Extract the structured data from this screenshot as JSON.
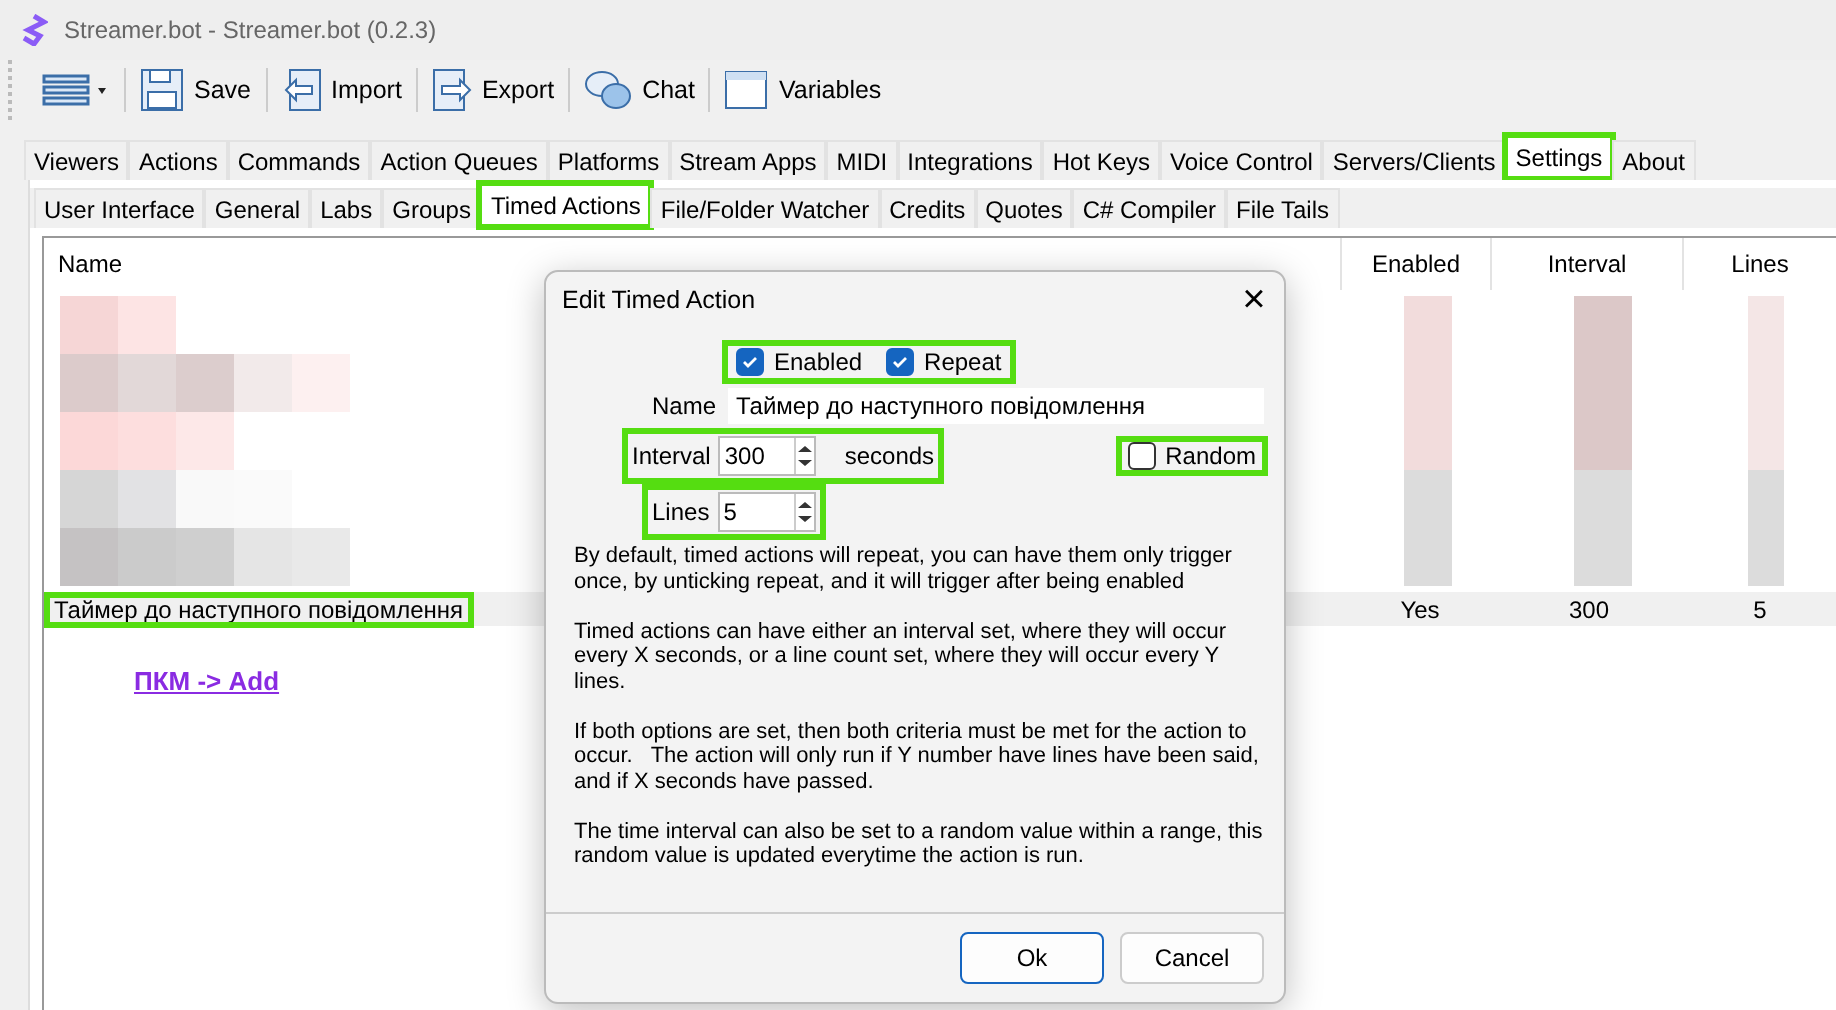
{
  "window": {
    "title": "Streamer.bot - Streamer.bot (0.2.3)"
  },
  "toolbar": [
    {
      "kind": "menu"
    },
    {
      "kind": "save",
      "label": "Save"
    },
    {
      "kind": "import",
      "label": "Import"
    },
    {
      "kind": "export",
      "label": "Export"
    },
    {
      "kind": "chat",
      "label": "Chat"
    },
    {
      "kind": "variables",
      "label": "Variables"
    }
  ],
  "tabs": [
    {
      "label": "Viewers",
      "selected": false,
      "highlighted": false
    },
    {
      "label": "Actions",
      "selected": false,
      "highlighted": false
    },
    {
      "label": "Commands",
      "selected": false,
      "highlighted": false
    },
    {
      "label": "Action Queues",
      "selected": false,
      "highlighted": false
    },
    {
      "label": "Platforms",
      "selected": false,
      "highlighted": false
    },
    {
      "label": "Stream Apps",
      "selected": false,
      "highlighted": false
    },
    {
      "label": "MIDI",
      "selected": false,
      "highlighted": false
    },
    {
      "label": "Integrations",
      "selected": false,
      "highlighted": false
    },
    {
      "label": "Hot Keys",
      "selected": false,
      "highlighted": false
    },
    {
      "label": "Voice Control",
      "selected": false,
      "highlighted": false
    },
    {
      "label": "Servers/Clients",
      "selected": false,
      "highlighted": false
    },
    {
      "label": "Settings",
      "selected": true,
      "highlighted": true
    },
    {
      "label": "About",
      "selected": false,
      "highlighted": false
    }
  ],
  "subtabs": [
    {
      "label": "User Interface",
      "selected": false,
      "highlighted": false
    },
    {
      "label": "General",
      "selected": false,
      "highlighted": false
    },
    {
      "label": "Labs",
      "selected": false,
      "highlighted": false
    },
    {
      "label": "Groups",
      "selected": false,
      "highlighted": false
    },
    {
      "label": "Timed Actions",
      "selected": true,
      "highlighted": true
    },
    {
      "label": "File/Folder Watcher",
      "selected": false,
      "highlighted": false
    },
    {
      "label": "Credits",
      "selected": false,
      "highlighted": false
    },
    {
      "label": "Quotes",
      "selected": false,
      "highlighted": false
    },
    {
      "label": "C# Compiler",
      "selected": false,
      "highlighted": false
    },
    {
      "label": "File Tails",
      "selected": false,
      "highlighted": false
    }
  ],
  "table": {
    "columns": [
      "Name",
      "Enabled",
      "Interval",
      "Lines"
    ],
    "rows": [
      {
        "cells": [
          "Таймер до наступного повідомлення",
          "Yes",
          "300",
          "5"
        ],
        "selected": true,
        "highlighted": true
      }
    ]
  },
  "annotation": {
    "text": "ПКМ -> Add"
  },
  "dialog": {
    "title": "Edit Timed Action",
    "close": "×",
    "enabled": {
      "label": "Enabled",
      "checked": true
    },
    "repeat": {
      "label": "Repeat",
      "checked": true
    },
    "checks_highlighted": true,
    "name": {
      "label": "Name",
      "value": "Таймер до наступного повідомлення"
    },
    "interval": {
      "label": "Interval",
      "value": "300",
      "unit": "seconds",
      "highlighted": true
    },
    "random": {
      "label": "Random",
      "checked": false,
      "highlighted": true
    },
    "lines": {
      "label": "Lines",
      "value": "5",
      "highlighted": true
    },
    "help": [
      "By default, timed actions will repeat, you can have them only trigger once, by unticking repeat, and it will trigger after being enabled",
      "Timed actions can have either an interval set, where they will occur every X seconds, or a line count set, where they will occur every Y lines.",
      "If both options are set, then both criteria must be met for the action to occur.   The action will only run if Y number have lines have been said, and if X seconds have passed.",
      "The time interval can also be set to a random value within a range, this random value is updated everytime the action is run."
    ],
    "buttons": [
      "Ok",
      "Cancel"
    ]
  }
}
